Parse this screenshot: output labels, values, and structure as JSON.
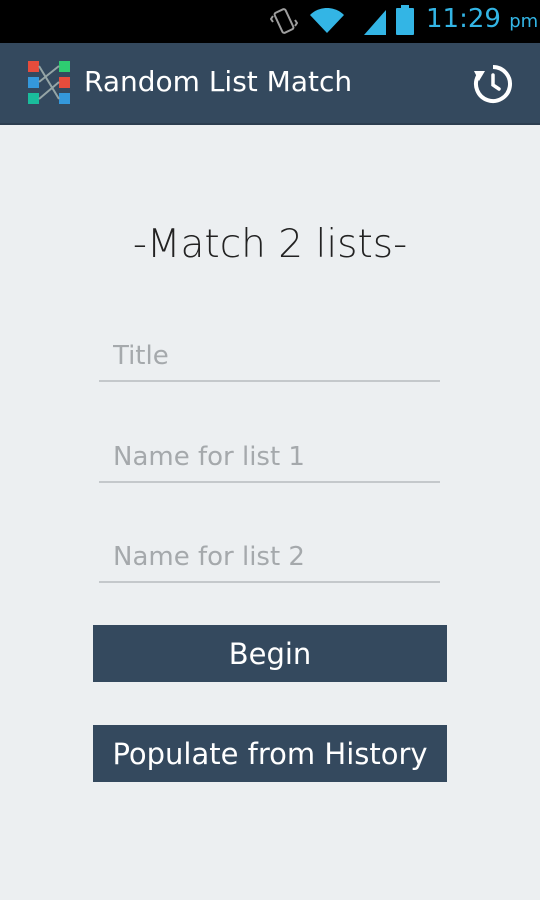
{
  "status_bar": {
    "time": "11:29",
    "ampm": "pm",
    "icons": [
      "vibrate-icon",
      "wifi-icon",
      "signal-icon",
      "battery-icon"
    ],
    "accent_color": "#33b5e5"
  },
  "action_bar": {
    "title": "Random List Match",
    "logo_icon": "app-logo-icon",
    "history_icon": "history-icon",
    "background": "#34495e"
  },
  "main": {
    "heading": "-Match 2 lists-",
    "fields": {
      "title_placeholder": "Title",
      "list1_placeholder": "Name for list 1",
      "list2_placeholder": "Name for list 2"
    },
    "buttons": {
      "begin": "Begin",
      "populate": "Populate from History"
    }
  }
}
